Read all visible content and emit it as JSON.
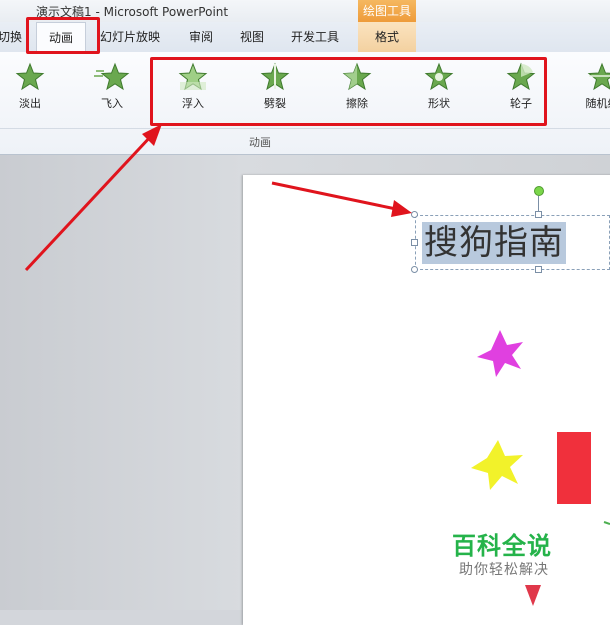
{
  "window": {
    "title": "演示文稿1 - Microsoft PowerPoint",
    "context_tab_group": "绘图工具"
  },
  "tabs": [
    {
      "label": "切换",
      "active": false
    },
    {
      "label": "动画",
      "active": true
    },
    {
      "label": "幻灯片放映",
      "active": false
    },
    {
      "label": "审阅",
      "active": false
    },
    {
      "label": "视图",
      "active": false
    },
    {
      "label": "开发工具",
      "active": false
    },
    {
      "label": "格式",
      "active": false
    }
  ],
  "ribbon": {
    "group_label": "动画",
    "animations": [
      {
        "label": "淡出",
        "icon": "fade-star-icon"
      },
      {
        "label": "飞入",
        "icon": "fly-in-star-icon"
      },
      {
        "label": "浮入",
        "icon": "float-in-star-icon"
      },
      {
        "label": "劈裂",
        "icon": "split-star-icon"
      },
      {
        "label": "擦除",
        "icon": "wipe-star-icon"
      },
      {
        "label": "形状",
        "icon": "shape-star-icon"
      },
      {
        "label": "轮子",
        "icon": "wheel-star-icon"
      },
      {
        "label": "随机线",
        "icon": "random-bars-star-icon"
      }
    ]
  },
  "slide": {
    "textbox_text": "搜狗指南",
    "shapes": [
      {
        "kind": "star",
        "color": "#e040e0"
      },
      {
        "kind": "star",
        "color": "#f2f22a"
      },
      {
        "kind": "rectangle",
        "color": "#f0303c"
      },
      {
        "kind": "triangle",
        "color": "#e0384a"
      }
    ]
  },
  "watermark": {
    "title": "百科全说",
    "subtitle": "助你轻松解决"
  },
  "colors": {
    "highlight": "#e0141d",
    "accent_orange": "#ee9b3a",
    "star_green": "#6aa84f"
  }
}
